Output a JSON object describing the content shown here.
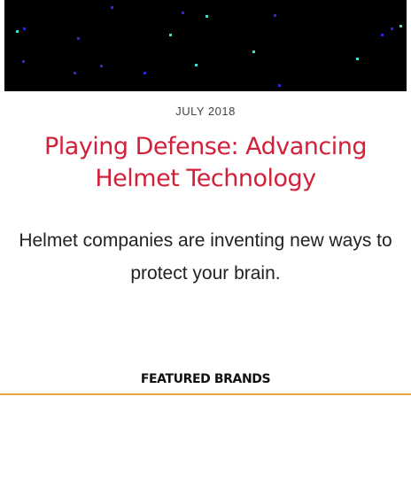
{
  "article": {
    "date": "JULY 2018",
    "title": "Playing Defense: Advancing Helmet Technology",
    "subtitle": "Helmet companies are inventing new ways to protect your brain."
  },
  "featured": {
    "label": "FEATURED BRANDS"
  },
  "colors": {
    "title": "#d3203a",
    "rule": "#e8a33c",
    "hero_bg": "#000000",
    "star_blue": "#2a2ad8",
    "star_cyan": "#3de0d0"
  }
}
